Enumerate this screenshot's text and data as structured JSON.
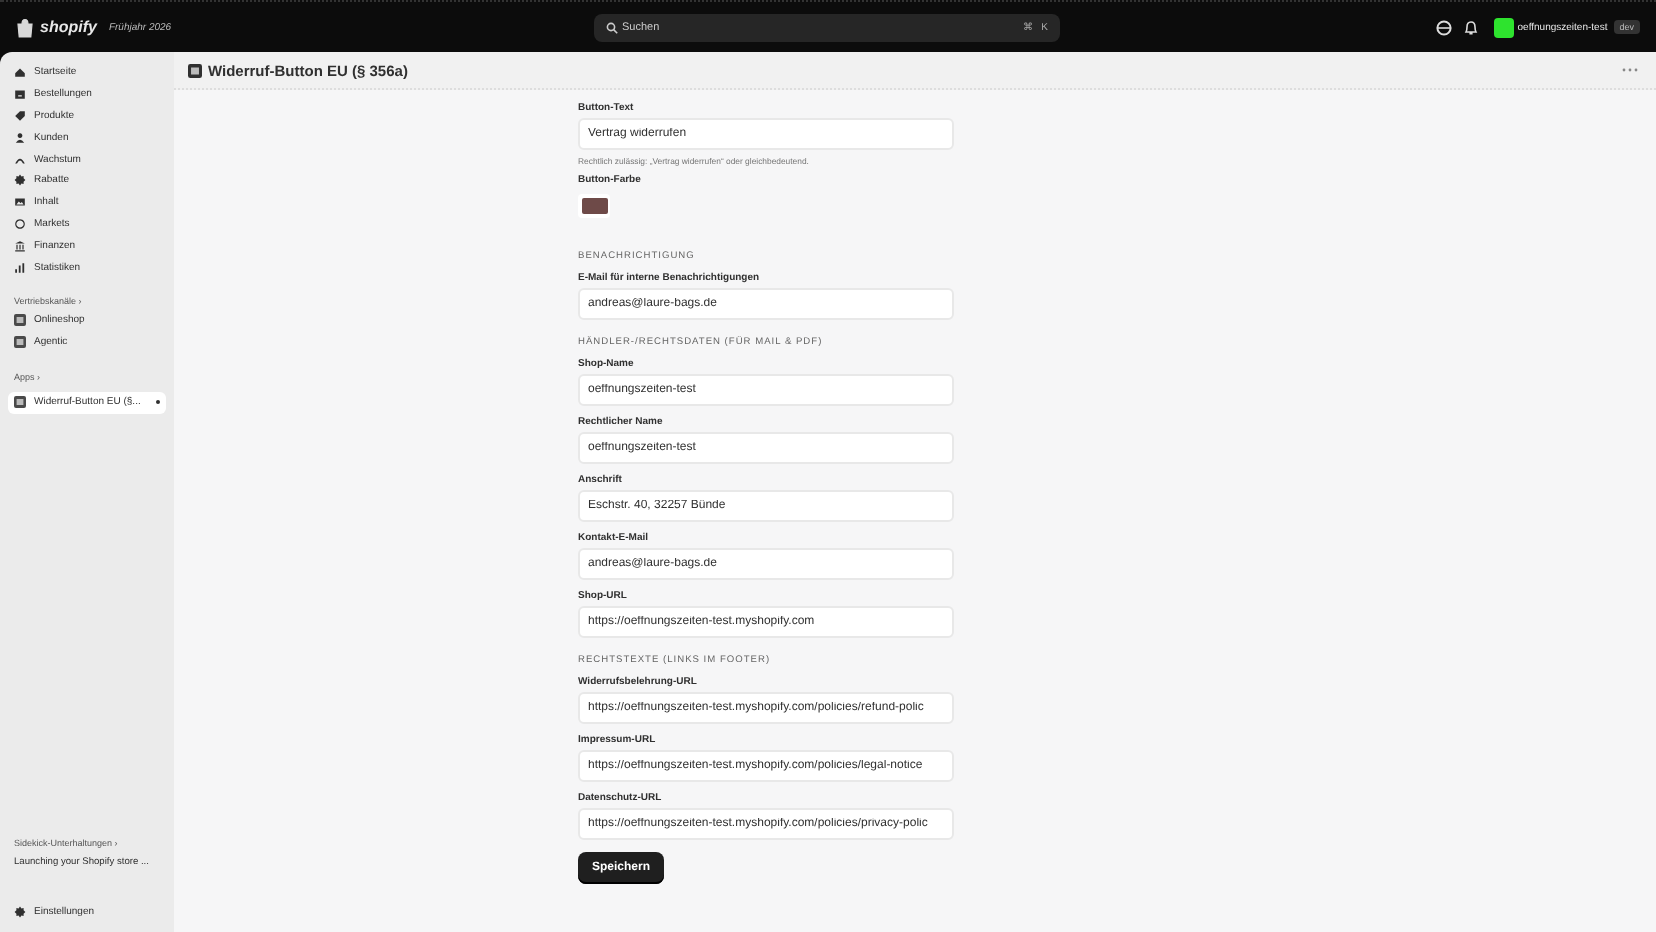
{
  "topbar": {
    "brand": "shopify",
    "edition": "Frühjahr 2026",
    "search": {
      "placeholder": "Suchen"
    },
    "shortcut": [
      "⌘",
      "K"
    ],
    "store": {
      "name": "oeffnungszeiten-test",
      "badge": "dev"
    }
  },
  "sidebar": {
    "items": [
      {
        "label": "Startseite",
        "selected": false
      },
      {
        "label": "Bestellungen",
        "selected": false
      },
      {
        "label": "Produkte",
        "selected": false
      },
      {
        "label": "Kunden",
        "selected": false
      },
      {
        "label": "Wachstum",
        "selected": false
      },
      {
        "label": "Rabatte",
        "selected": false
      },
      {
        "label": "Inhalt",
        "selected": false
      },
      {
        "label": "Markets",
        "selected": false
      },
      {
        "label": "Finanzen",
        "selected": false
      },
      {
        "label": "Statistiken",
        "selected": false
      }
    ],
    "channels": {
      "heading": "Vertriebskanäle ›",
      "items": [
        {
          "label": "Onlineshop",
          "selected": false
        },
        {
          "label": "Agentic",
          "selected": false
        }
      ]
    },
    "apps": {
      "heading": "Apps ›",
      "items": [
        {
          "label": "Widerruf-Button EU (§...",
          "selected": true
        }
      ]
    },
    "sidekick": {
      "heading": "Sidekick-Unterhaltungen ›",
      "items": [
        {
          "label": "Launching your Shopify store ...",
          "selected": false
        }
      ]
    },
    "settings": "Einstellungen"
  },
  "page": {
    "title": "Widerruf-Button EU (§ 356a)"
  },
  "form": {
    "items": [
      {
        "kind": "field",
        "label": "Button-Text",
        "value": "Vertrag widerrufen",
        "hint": "Rechtlich zulässig: „Vertrag widerrufen“ oder gleichbedeutend."
      },
      {
        "kind": "color",
        "label": "Button-Farbe",
        "color": "#6e4a48"
      },
      {
        "kind": "heading",
        "text": "BENACHRICHTIGUNG"
      },
      {
        "kind": "field",
        "label": "E-Mail für interne Benachrichtigungen",
        "value": "andreas@laure-bags.de"
      },
      {
        "kind": "heading",
        "text": "HÄNDLER-/RECHTSDATEN (FÜR MAIL & PDF)"
      },
      {
        "kind": "field",
        "label": "Shop-Name",
        "value": "oeffnungszeiten-test"
      },
      {
        "kind": "field",
        "label": "Rechtlicher Name",
        "value": "oeffnungszeiten-test"
      },
      {
        "kind": "field",
        "label": "Anschrift",
        "value": "Eschstr. 40, 32257 Bünde"
      },
      {
        "kind": "field",
        "label": "Kontakt-E-Mail",
        "value": "andreas@laure-bags.de"
      },
      {
        "kind": "field",
        "label": "Shop-URL",
        "value": "https://oeffnungszeiten-test.myshopify.com"
      },
      {
        "kind": "heading",
        "text": "RECHTSTEXTE (LINKS IM FOOTER)"
      },
      {
        "kind": "field",
        "label": "Widerrufsbelehrung-URL",
        "value": "https://oeffnungszeiten-test.myshopify.com/policies/refund-polic"
      },
      {
        "kind": "field",
        "label": "Impressum-URL",
        "value": "https://oeffnungszeiten-test.myshopify.com/policies/legal-notice"
      },
      {
        "kind": "field",
        "label": "Datenschutz-URL",
        "value": "https://oeffnungszeiten-test.myshopify.com/policies/privacy-polic"
      }
    ],
    "save_button": "Speichern"
  }
}
